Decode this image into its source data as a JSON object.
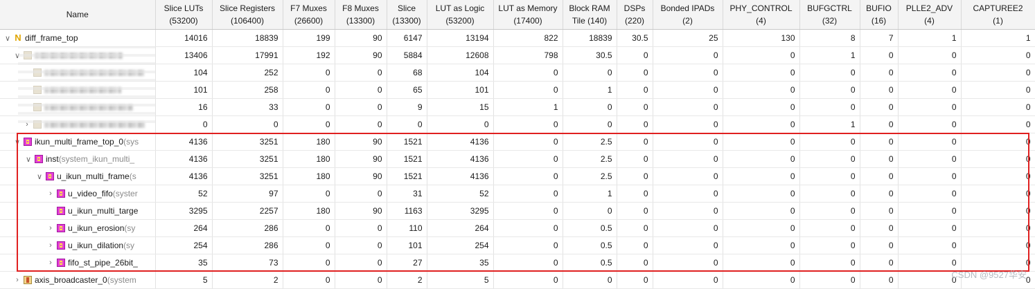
{
  "table": {
    "columns": [
      {
        "line1": "Name",
        "line2": ""
      },
      {
        "line1": "Slice LUTs",
        "line2": "(53200)"
      },
      {
        "line1": "Slice Registers",
        "line2": "(106400)"
      },
      {
        "line1": "F7 Muxes",
        "line2": "(26600)"
      },
      {
        "line1": "F8 Muxes",
        "line2": "(13300)"
      },
      {
        "line1": "Slice",
        "line2": "(13300)"
      },
      {
        "line1": "LUT as Logic",
        "line2": "(53200)"
      },
      {
        "line1": "LUT as Memory",
        "line2": "(17400)"
      },
      {
        "line1": "Block RAM",
        "line2": "Tile (140)"
      },
      {
        "line1": "DSPs",
        "line2": "(220)"
      },
      {
        "line1": "Bonded IPADs",
        "line2": "(2)"
      },
      {
        "line1": "PHY_CONTROL",
        "line2": "(4)"
      },
      {
        "line1": "BUFGCTRL",
        "line2": "(32)"
      },
      {
        "line1": "BUFIO",
        "line2": "(16)"
      },
      {
        "line1": "PLLE2_ADV",
        "line2": "(4)"
      },
      {
        "line1": "CAPTUREE2",
        "line2": "(1)"
      }
    ],
    "rows": [
      {
        "name": "diff_frame_top",
        "suffix": "",
        "toggle": "∨",
        "icon": "top-module-icon",
        "values": [
          "14016",
          "18839",
          "199",
          "90",
          "6147",
          "13194",
          "822",
          "18839",
          "30.5",
          "25",
          "130",
          "8",
          "7",
          "1",
          "1"
        ]
      },
      {
        "name": "",
        "suffix": "",
        "toggle": "∨",
        "icon": "blurred-icon",
        "values": [
          "13406",
          "17991",
          "192",
          "90",
          "5884",
          "12608",
          "798",
          "30.5",
          "0",
          "0",
          "0",
          "1",
          "0",
          "0",
          "0"
        ]
      },
      {
        "name": "",
        "suffix": "",
        "toggle": "",
        "icon": "blurred-icon",
        "values": [
          "104",
          "252",
          "0",
          "0",
          "68",
          "104",
          "0",
          "0",
          "0",
          "0",
          "0",
          "0",
          "0",
          "0",
          "0"
        ]
      },
      {
        "name": "",
        "suffix": "",
        "toggle": "",
        "icon": "blurred-icon",
        "values": [
          "101",
          "258",
          "0",
          "0",
          "65",
          "101",
          "0",
          "1",
          "0",
          "0",
          "0",
          "0",
          "0",
          "0",
          "0"
        ]
      },
      {
        "name": "",
        "suffix": "",
        "toggle": "",
        "icon": "blurred-icon",
        "values": [
          "16",
          "33",
          "0",
          "0",
          "9",
          "15",
          "1",
          "0",
          "0",
          "0",
          "0",
          "0",
          "0",
          "0",
          "0"
        ]
      },
      {
        "name": "",
        "suffix": "",
        "toggle": "›",
        "icon": "blurred-icon",
        "values": [
          "0",
          "0",
          "0",
          "0",
          "0",
          "0",
          "0",
          "0",
          "0",
          "0",
          "0",
          "1",
          "0",
          "0",
          "0"
        ]
      },
      {
        "name": "ikun_multi_frame_top_0",
        "suffix": " (sys",
        "toggle": "∨",
        "icon": "module-icon",
        "values": [
          "4136",
          "3251",
          "180",
          "90",
          "1521",
          "4136",
          "0",
          "2.5",
          "0",
          "0",
          "0",
          "0",
          "0",
          "0",
          "0"
        ]
      },
      {
        "name": "inst",
        "suffix": " (system_ikun_multi_",
        "toggle": "∨",
        "icon": "module-icon",
        "values": [
          "4136",
          "3251",
          "180",
          "90",
          "1521",
          "4136",
          "0",
          "2.5",
          "0",
          "0",
          "0",
          "0",
          "0",
          "0",
          "0"
        ]
      },
      {
        "name": "u_ikun_multi_frame",
        "suffix": " (s",
        "toggle": "∨",
        "icon": "module-icon",
        "values": [
          "4136",
          "3251",
          "180",
          "90",
          "1521",
          "4136",
          "0",
          "2.5",
          "0",
          "0",
          "0",
          "0",
          "0",
          "0",
          "0"
        ]
      },
      {
        "name": "u_video_fifo",
        "suffix": " (syster",
        "toggle": "›",
        "icon": "module-icon",
        "values": [
          "52",
          "97",
          "0",
          "0",
          "31",
          "52",
          "0",
          "1",
          "0",
          "0",
          "0",
          "0",
          "0",
          "0",
          "0"
        ]
      },
      {
        "name": "u_ikun_multi_targe",
        "suffix": "",
        "toggle": "",
        "icon": "module-icon",
        "values": [
          "3295",
          "2257",
          "180",
          "90",
          "1163",
          "3295",
          "0",
          "0",
          "0",
          "0",
          "0",
          "0",
          "0",
          "0",
          "0"
        ]
      },
      {
        "name": "u_ikun_erosion",
        "suffix": " (sy",
        "toggle": "›",
        "icon": "module-icon",
        "values": [
          "264",
          "286",
          "0",
          "0",
          "110",
          "264",
          "0",
          "0.5",
          "0",
          "0",
          "0",
          "0",
          "0",
          "0",
          "0"
        ]
      },
      {
        "name": "u_ikun_dilation",
        "suffix": " (sy",
        "toggle": "›",
        "icon": "module-icon",
        "values": [
          "254",
          "286",
          "0",
          "0",
          "101",
          "254",
          "0",
          "0.5",
          "0",
          "0",
          "0",
          "0",
          "0",
          "0",
          "0"
        ]
      },
      {
        "name": "fifo_st_pipe_26bit_",
        "suffix": "",
        "toggle": "›",
        "icon": "module-icon",
        "values": [
          "35",
          "73",
          "0",
          "0",
          "27",
          "35",
          "0",
          "0.5",
          "0",
          "0",
          "0",
          "0",
          "0",
          "0",
          "0"
        ]
      },
      {
        "name": "axis_broadcaster_0",
        "suffix": " (system",
        "toggle": "›",
        "icon": "ip-icon",
        "values": [
          "5",
          "2",
          "0",
          "0",
          "2",
          "5",
          "0",
          "0",
          "0",
          "0",
          "0",
          "0",
          "0",
          "0",
          "0"
        ]
      }
    ]
  },
  "watermark": "CSDN @9527华安"
}
